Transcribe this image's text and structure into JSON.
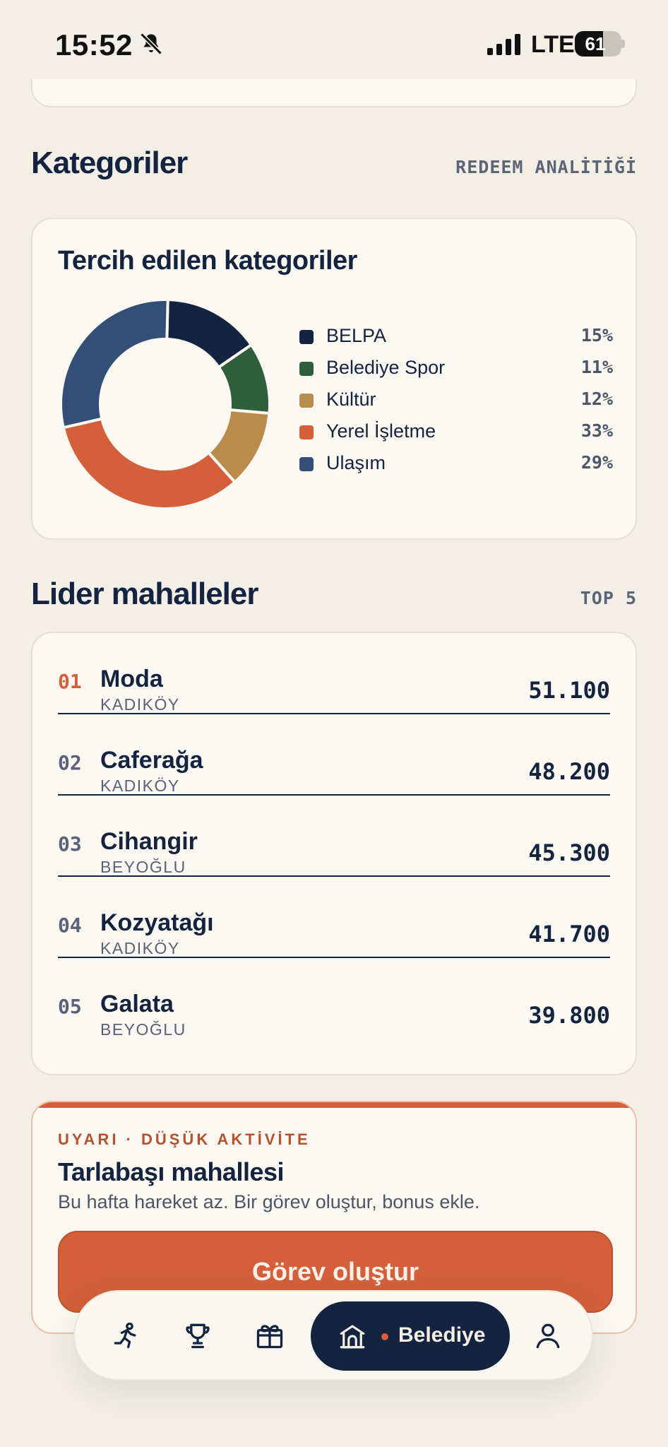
{
  "status_bar": {
    "time": "15:52",
    "network": "LTE",
    "battery": "61",
    "battery_level": 0.61
  },
  "categories_section": {
    "title": "Kategoriler",
    "link": "REDEEM ANALİTİĞİ",
    "card_title": "Tercih edilen kategoriler",
    "legend": [
      {
        "label": "BELPA",
        "percent": "15%",
        "color": "#14233f"
      },
      {
        "label": "Belediye Spor",
        "percent": "11%",
        "color": "#2f5e3d"
      },
      {
        "label": "Kültür",
        "percent": "12%",
        "color": "#b98c4d"
      },
      {
        "label": "Yerel İşletme",
        "percent": "33%",
        "color": "#d3603a"
      },
      {
        "label": "Ulaşım",
        "percent": "29%",
        "color": "#344f77"
      }
    ]
  },
  "chart_data": {
    "type": "pie",
    "title": "Tercih edilen kategoriler",
    "categories": [
      "BELPA",
      "Belediye Spor",
      "Kültür",
      "Yerel İşletme",
      "Ulaşım"
    ],
    "values": [
      15,
      11,
      12,
      33,
      29
    ],
    "colors": [
      "#14233f",
      "#2f5e3d",
      "#b98c4d",
      "#d3603a",
      "#344f77"
    ],
    "legend_position": "right"
  },
  "leaders_section": {
    "title": "Lider mahalleler",
    "link": "TOP 5",
    "rows": [
      {
        "rank": "01",
        "name": "Moda",
        "district": "KADIKÖY",
        "score": "51.100"
      },
      {
        "rank": "02",
        "name": "Caferağa",
        "district": "KADIKÖY",
        "score": "48.200"
      },
      {
        "rank": "03",
        "name": "Cihangir",
        "district": "BEYOĞLU",
        "score": "45.300"
      },
      {
        "rank": "04",
        "name": "Kozyatağı",
        "district": "KADIKÖY",
        "score": "41.700"
      },
      {
        "rank": "05",
        "name": "Galata",
        "district": "BEYOĞLU",
        "score": "39.800"
      }
    ]
  },
  "alert": {
    "eyebrow": "UYARI · DÜŞÜK AKTİVİTE",
    "title": "Tarlabaşı mahallesi",
    "description": "Bu hafta hareket az. Bir görev oluştur, bonus ekle.",
    "cta": "Görev oluştur"
  },
  "bottom_nav": {
    "items": [
      {
        "icon": "running-person-icon"
      },
      {
        "icon": "trophy-icon"
      },
      {
        "icon": "gift-icon"
      },
      {
        "icon": "municipality-building-icon",
        "label": "Belediye",
        "active": true
      },
      {
        "icon": "profile-person-icon"
      }
    ]
  },
  "colors": {
    "accent": "#d3603a",
    "navy": "#14233f",
    "background": "#f3efe6",
    "card": "#fbf8f1"
  }
}
